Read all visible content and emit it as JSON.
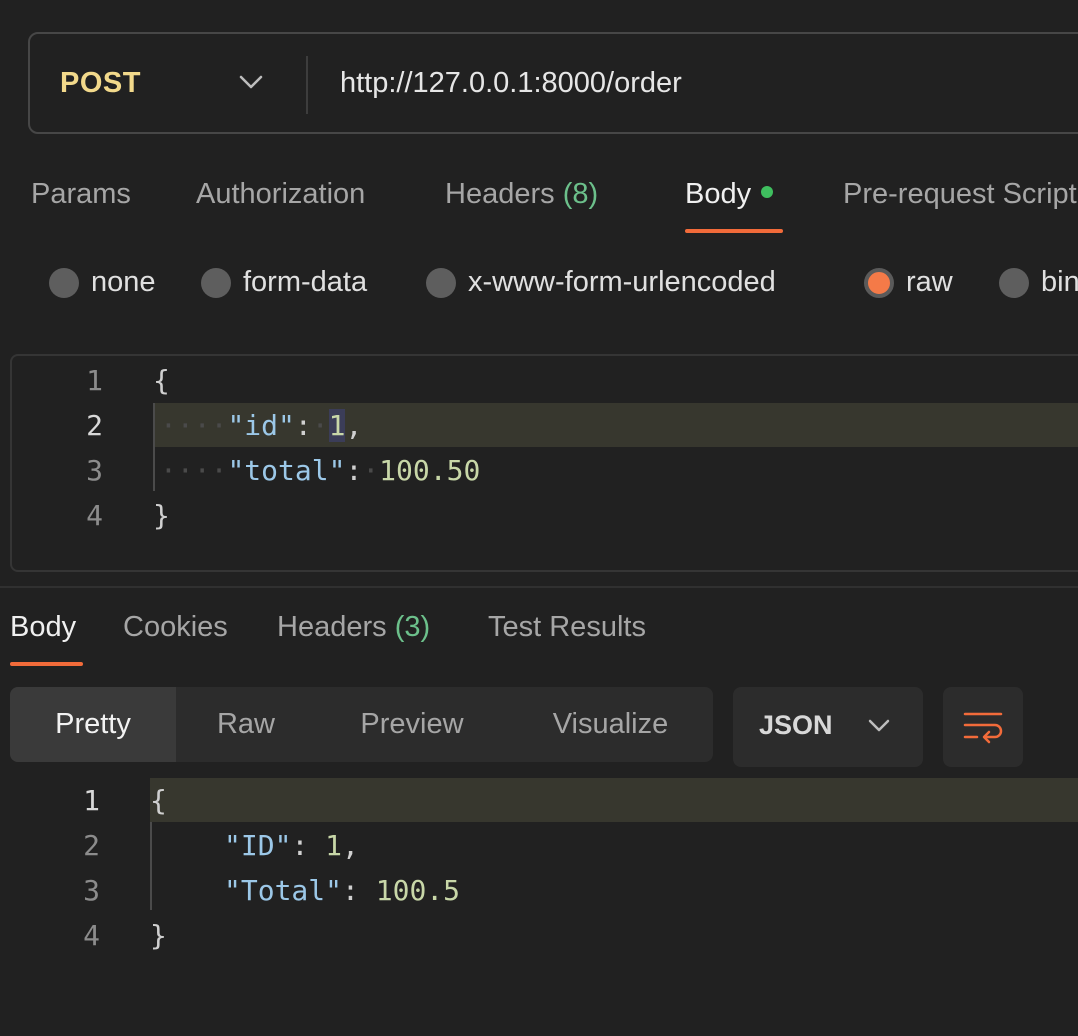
{
  "request": {
    "method": "POST",
    "url": "http://127.0.0.1:8000/order"
  },
  "request_tabs": {
    "params": "Params",
    "authorization": "Authorization",
    "headers": "Headers",
    "headers_count": "(8)",
    "body": "Body",
    "pre_request": "Pre-request Script"
  },
  "body_types": {
    "none": "none",
    "form_data": "form-data",
    "urlencoded": "x-www-form-urlencoded",
    "raw": "raw",
    "binary": "binary",
    "selected": "raw"
  },
  "request_body": {
    "line_numbers": [
      "1",
      "2",
      "3",
      "4"
    ],
    "open_brace": "{",
    "close_brace": "}",
    "id_key": "\"id\"",
    "id_value": "1",
    "total_key": "\"total\"",
    "total_value": "100.50"
  },
  "response_tabs": {
    "body": "Body",
    "cookies": "Cookies",
    "headers": "Headers",
    "headers_count": "(3)",
    "test_results": "Test Results"
  },
  "view_modes": {
    "pretty": "Pretty",
    "raw": "Raw",
    "preview": "Preview",
    "visualize": "Visualize",
    "selected": "Pretty"
  },
  "format_select": "JSON",
  "response_body": {
    "line_numbers": [
      "1",
      "2",
      "3",
      "4"
    ],
    "open_brace": "{",
    "close_brace": "}",
    "id_key": "\"ID\"",
    "id_value": "1",
    "total_key": "\"Total\"",
    "total_value": "100.5"
  },
  "colors": {
    "method": "#f2d98b",
    "accent": "#f26b3a",
    "count": "#6cc08b",
    "json_key": "#9cc8e8",
    "json_number": "#c8d7a8"
  },
  "icons": [
    "chevron-down-icon",
    "status-dot-icon",
    "wrap-lines-icon"
  ]
}
